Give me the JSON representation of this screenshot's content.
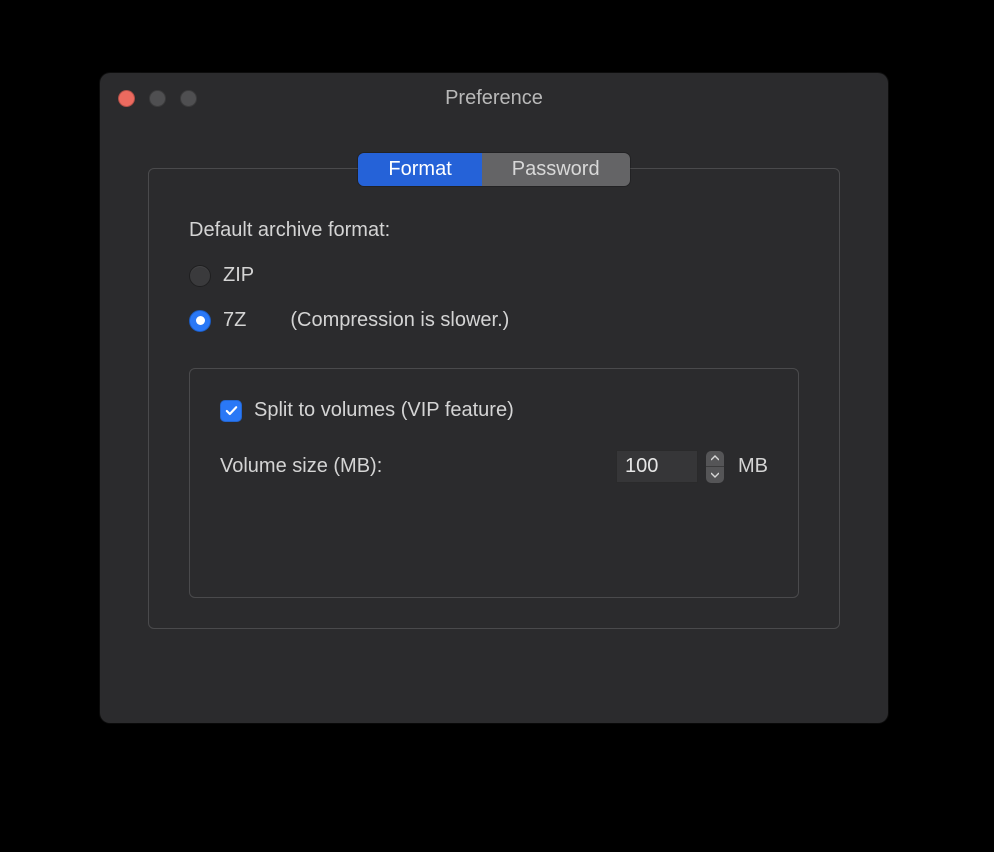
{
  "window": {
    "title": "Preference"
  },
  "tabs": {
    "format": "Format",
    "password": "Password",
    "active": "format"
  },
  "format_panel": {
    "default_label": "Default archive format:",
    "options": {
      "zip": "ZIP",
      "sevenz": "7Z"
    },
    "sevenz_hint": "(Compression is slower.)",
    "selected": "sevenz",
    "split": {
      "checked": true,
      "label": "Split to volumes (VIP feature)",
      "size_label": "Volume size (MB):",
      "size_value": "100",
      "unit": "MB"
    }
  }
}
